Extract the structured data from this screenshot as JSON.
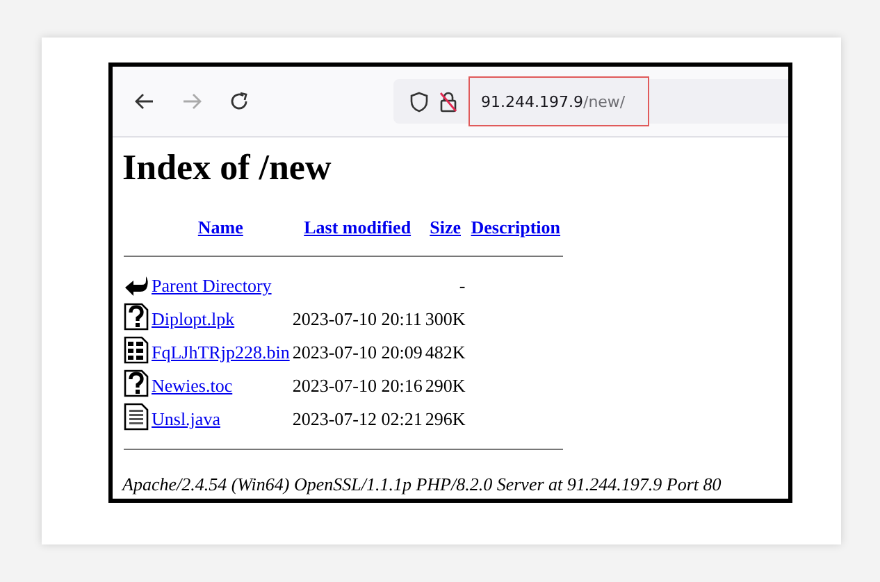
{
  "browser": {
    "url": {
      "host": "91.244.197.9",
      "path": "/new/",
      "highlighted": true
    }
  },
  "page": {
    "heading": "Index of /new",
    "columns": [
      "Name",
      "Last modified",
      "Size",
      "Description"
    ],
    "rows": [
      {
        "kind": "back",
        "name": "Parent Directory",
        "modified": "",
        "size": "-"
      },
      {
        "kind": "unknown",
        "name": "Diplopt.lpk",
        "modified": "2023-07-10 20:11",
        "size": "300K"
      },
      {
        "kind": "binary",
        "name": "FqLJhTRjp228.bin",
        "modified": "2023-07-10 20:09",
        "size": "482K"
      },
      {
        "kind": "unknown",
        "name": "Newies.toc",
        "modified": "2023-07-10 20:16",
        "size": "290K"
      },
      {
        "kind": "text",
        "name": "Unsl.java",
        "modified": "2023-07-12 02:21",
        "size": "296K"
      }
    ],
    "footer": "Apache/2.4.54 (Win64) OpenSSL/1.1.1p PHP/8.2.0 Server at 91.244.197.9 Port 80"
  }
}
